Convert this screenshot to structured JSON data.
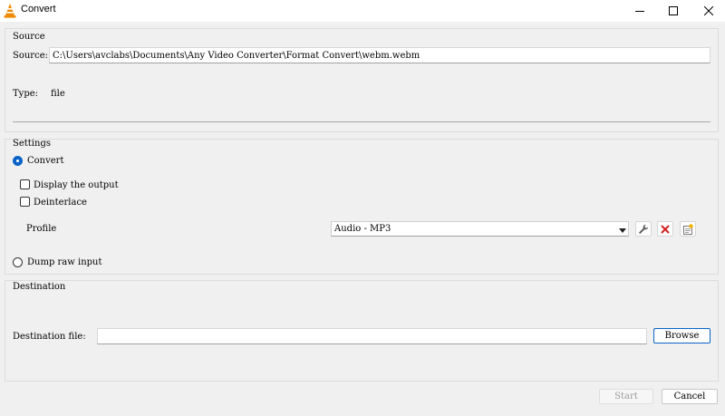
{
  "window": {
    "title": "Convert",
    "icon": "vlc-cone-icon",
    "controls": [
      "minimize-icon",
      "maximize-icon",
      "close-icon"
    ]
  },
  "source": {
    "group_title": "Source",
    "source_label": "Source:",
    "source_value": "C:\\Users\\avclabs\\Documents\\Any Video Converter\\Format Convert\\webm.webm",
    "type_label": "Type:",
    "type_value": "file"
  },
  "settings": {
    "group_title": "Settings",
    "convert_label": "Convert",
    "convert_selected": true,
    "display_output_label": "Display the output",
    "display_output_checked": false,
    "deinterlace_label": "Deinterlace",
    "deinterlace_checked": false,
    "profile_label": "Profile",
    "profile_value": "Audio - MP3",
    "profile_icons": [
      "wrench-icon",
      "delete-x-icon",
      "new-profile-icon"
    ],
    "dump_raw_label": "Dump raw input",
    "dump_raw_selected": false
  },
  "destination": {
    "group_title": "Destination",
    "file_label": "Destination file:",
    "file_value": "",
    "browse_label": "Browse"
  },
  "footer": {
    "start_label": "Start",
    "start_enabled": false,
    "cancel_label": "Cancel"
  },
  "colors": {
    "accent": "#0a64c8",
    "delete": "#d42020",
    "vlc_orange": "#f08a00"
  }
}
